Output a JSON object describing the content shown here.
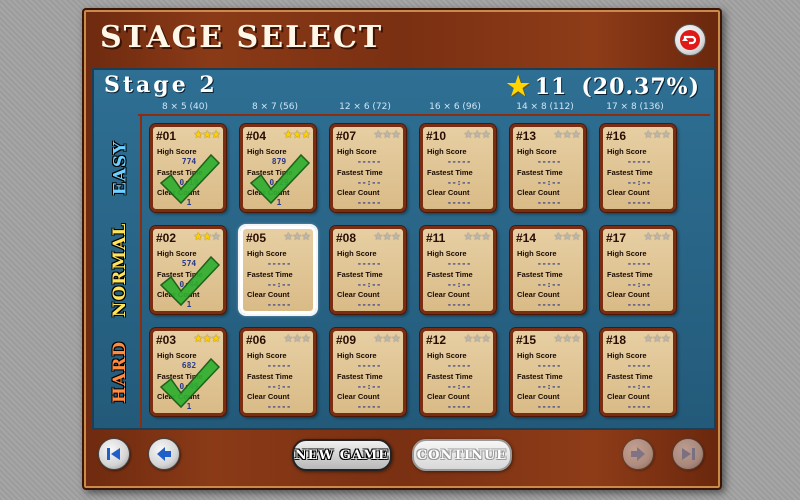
{
  "header": {
    "title": "STAGE SELECT"
  },
  "stage": {
    "label": "Stage 2",
    "star_count": "11",
    "percent": "(20.37%)"
  },
  "columns": [
    "8 × 5 (40)",
    "8 × 7 (56)",
    "12 × 6 (72)",
    "16 × 6 (96)",
    "14 × 8 (112)",
    "17 × 8 (136)"
  ],
  "rows": [
    {
      "label": "EASY",
      "color": "#6fd0ff"
    },
    {
      "label": "NORMAL",
      "color": "#ffe35a"
    },
    {
      "label": "HARD",
      "color": "#ff8a40"
    }
  ],
  "card_labels": {
    "high_score": "High Score",
    "fastest_time": "Fastest Time",
    "clear_count": "Clear Count"
  },
  "cards": [
    {
      "id": "#01",
      "stars": 3,
      "high_score": "774",
      "fastest_time": "0:10",
      "clear_count": "1",
      "cleared": true
    },
    {
      "id": "#04",
      "stars": 3,
      "high_score": "879",
      "fastest_time": "0:29",
      "clear_count": "1",
      "cleared": true
    },
    {
      "id": "#07",
      "stars": 0,
      "high_score": "-----",
      "fastest_time": "--:--",
      "clear_count": "-----",
      "cleared": false
    },
    {
      "id": "#10",
      "stars": 0,
      "high_score": "-----",
      "fastest_time": "--:--",
      "clear_count": "-----",
      "cleared": false
    },
    {
      "id": "#13",
      "stars": 0,
      "high_score": "-----",
      "fastest_time": "--:--",
      "clear_count": "-----",
      "cleared": false
    },
    {
      "id": "#16",
      "stars": 0,
      "high_score": "-----",
      "fastest_time": "--:--",
      "clear_count": "-----",
      "cleared": false
    },
    {
      "id": "#02",
      "stars": 2,
      "high_score": "574",
      "fastest_time": "0:44",
      "clear_count": "1",
      "cleared": true
    },
    {
      "id": "#05",
      "stars": 0,
      "high_score": "-----",
      "fastest_time": "--:--",
      "clear_count": "-----",
      "cleared": false,
      "selected": true
    },
    {
      "id": "#08",
      "stars": 0,
      "high_score": "-----",
      "fastest_time": "--:--",
      "clear_count": "-----",
      "cleared": false
    },
    {
      "id": "#11",
      "stars": 0,
      "high_score": "-----",
      "fastest_time": "--:--",
      "clear_count": "-----",
      "cleared": false
    },
    {
      "id": "#14",
      "stars": 0,
      "high_score": "-----",
      "fastest_time": "--:--",
      "clear_count": "-----",
      "cleared": false
    },
    {
      "id": "#17",
      "stars": 0,
      "high_score": "-----",
      "fastest_time": "--:--",
      "clear_count": "-----",
      "cleared": false
    },
    {
      "id": "#03",
      "stars": 3,
      "high_score": "682",
      "fastest_time": "0:49",
      "clear_count": "1",
      "cleared": true
    },
    {
      "id": "#06",
      "stars": 0,
      "high_score": "-----",
      "fastest_time": "--:--",
      "clear_count": "-----",
      "cleared": false
    },
    {
      "id": "#09",
      "stars": 0,
      "high_score": "-----",
      "fastest_time": "--:--",
      "clear_count": "-----",
      "cleared": false
    },
    {
      "id": "#12",
      "stars": 0,
      "high_score": "-----",
      "fastest_time": "--:--",
      "clear_count": "-----",
      "cleared": false
    },
    {
      "id": "#15",
      "stars": 0,
      "high_score": "-----",
      "fastest_time": "--:--",
      "clear_count": "-----",
      "cleared": false
    },
    {
      "id": "#18",
      "stars": 0,
      "high_score": "-----",
      "fastest_time": "--:--",
      "clear_count": "-----",
      "cleared": false
    }
  ],
  "footer": {
    "new_game": "NEW GAME",
    "continue": "CONTINUE",
    "icons": [
      "first-page-icon",
      "previous-icon",
      "next-icon",
      "last-page-icon"
    ]
  },
  "icons": {
    "back": "return-arrow-icon",
    "star": "star-icon",
    "check": "checkmark-icon"
  }
}
